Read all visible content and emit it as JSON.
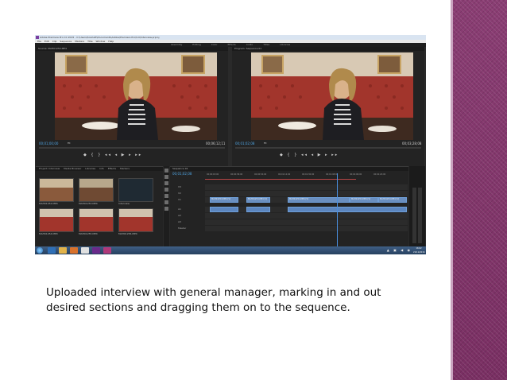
{
  "app": {
    "title_bar": "Adobe Premiere Pro CC 2015 - C:\\Users\\Scarlett\\Documents\\Adobe\\Premiere Pro\\9.0\\Interview.prproj",
    "menu": [
      "File",
      "Edit",
      "Clip",
      "Sequence",
      "Markers",
      "Title",
      "Window",
      "Help"
    ],
    "workspaces": [
      "Assembly",
      "Editing",
      "Color",
      "Effects",
      "Audio",
      "Titles",
      "Libraries"
    ]
  },
  "source_monitor": {
    "tab": "Source: MAH01254.MP4",
    "timecode": "00;01;00;00",
    "fit": "Fit",
    "duration": "00;06;12;11",
    "transport": "◆ { } ◂◂ ◂ ▶ ▸ ▸▸"
  },
  "program_monitor": {
    "tab": "Program: Sequence 01",
    "timecode": "00;01;02;08",
    "fit": "Fit",
    "duration": "00;03;28;08",
    "transport": "◆ { } ◂◂ ◂ ▶ ▸ ▸▸"
  },
  "project_panel": {
    "tabs": [
      "Project: Interview",
      "Media Browser",
      "Libraries",
      "Info",
      "Effects",
      "Markers"
    ],
    "items": [
      {
        "label": "MAH01252.MP4"
      },
      {
        "label": "MAH01253.MP4"
      },
      {
        "label": "Interview"
      },
      {
        "label": "MAH01254.MP4"
      },
      {
        "label": "MAH01255.MP4"
      },
      {
        "label": "MAH01256.MP4"
      }
    ]
  },
  "timeline": {
    "tab": "Sequence 01",
    "timecode": "00;01;02;08",
    "ruler": [
      "00;00;18;00",
      "00;00;36;00",
      "00;00;54;00",
      "00;01;12;00",
      "00;01;30;00",
      "00;01;48;00",
      "00;02;06;00",
      "00;02;24;00"
    ],
    "tracks": [
      "V3",
      "V2",
      "V1",
      "A1",
      "A2",
      "A3",
      "Master"
    ],
    "clips": [
      {
        "label": "MAH01254.MP4 [V]"
      },
      {
        "label": "MAH01254.MP4 [V]"
      },
      {
        "label": "MAH01254.MP4 [V]"
      },
      {
        "label": "MAH01254.MP4 [V]"
      },
      {
        "label": "MAH01254.MP4 [V]"
      }
    ]
  },
  "taskbar": {
    "tray": "▲ ▣ ◀ ◉",
    "time": "16:02",
    "date": "21/11/2016"
  },
  "caption": {
    "line1": "Uploaded interview with general manager, marking in and out",
    "line2": "desired sections and dragging them on to the sequence."
  },
  "colors": {
    "band": "#7a2f63",
    "timecode": "#4fa3e0",
    "clip": "#6a8fc0",
    "in_out": "#b84646"
  }
}
